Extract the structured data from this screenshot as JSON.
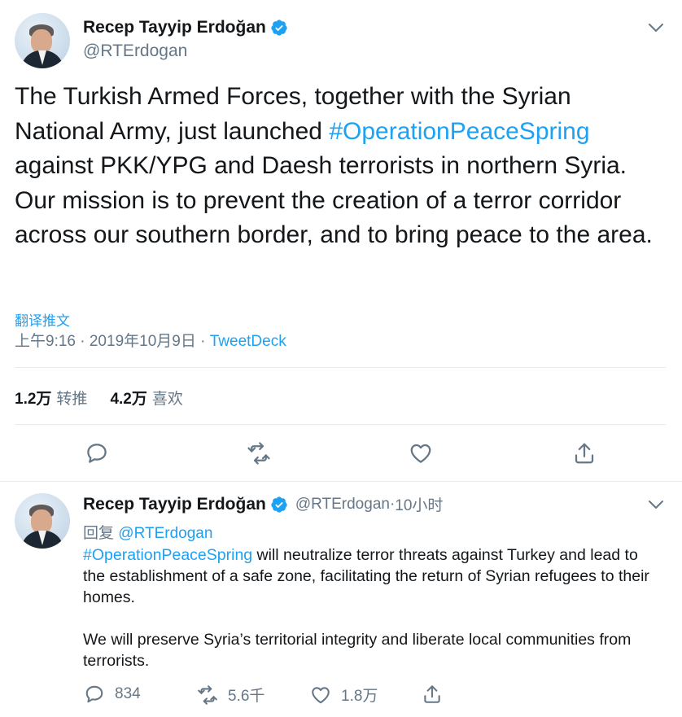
{
  "main_tweet": {
    "author": {
      "display_name": "Recep Tayyip Erdoğan",
      "handle": "@RTErdogan",
      "verified": true
    },
    "text": {
      "part1": "The Turkish Armed Forces, together with the Syrian National Army, just launched ",
      "hashtag": "#OperationPeaceSpring",
      "part2": " against PKK/YPG and Daesh terrorists in northern Syria. Our mission is to prevent the creation of a terror corridor across our southern border, and to bring peace to the area."
    },
    "translate_label": "翻译推文",
    "timestamp": "上午9:16 · 2019年10月9日 · ",
    "source": "TweetDeck",
    "stats": {
      "retweets_count": "1.2万",
      "retweets_label": "转推",
      "likes_count": "4.2万",
      "likes_label": "喜欢"
    },
    "actions": [
      "reply-icon",
      "retweet-icon",
      "like-icon",
      "share-icon"
    ]
  },
  "reply_tweet": {
    "author": {
      "display_name": "Recep Tayyip Erdoğan",
      "handle": "@RTErdogan",
      "separator": " · ",
      "time_ago": "10小时",
      "verified": true
    },
    "reply_to_label": "回复",
    "reply_to_handle": "@RTErdogan",
    "text": {
      "hashtag": "#OperationPeaceSpring",
      "para1_rest": " will neutralize terror threats against Turkey and lead to the establishment of a safe zone, facilitating the return of Syrian refugees to their homes.",
      "para2": "We will preserve Syria’s territorial integrity and liberate local communities from terrorists."
    },
    "actions": {
      "reply_count": "834",
      "retweet_count": "5.6千",
      "like_count": "1.8万"
    }
  },
  "colors": {
    "accent": "#1da1f2",
    "text": "#14171a",
    "secondary_text": "#657786",
    "border": "#e6ecf0"
  }
}
